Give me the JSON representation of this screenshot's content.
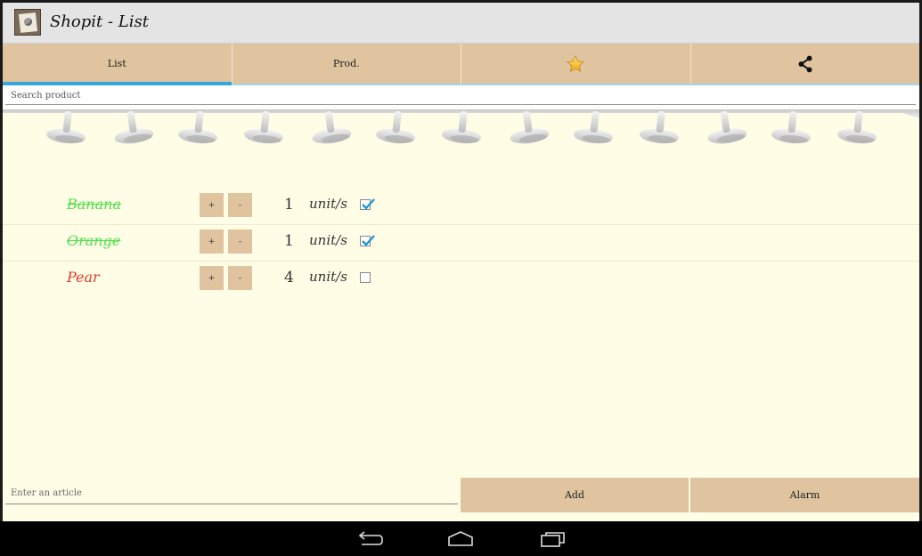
{
  "app": {
    "title": "Shopit - List"
  },
  "tabs": [
    {
      "label": "List",
      "active": true
    },
    {
      "label": "Prod.",
      "active": false
    },
    {
      "icon": "star-icon",
      "active": false
    },
    {
      "icon": "share-icon",
      "active": false
    }
  ],
  "search": {
    "placeholder": "Search product"
  },
  "list": {
    "items": [
      {
        "name": "Banana",
        "plus_label": "+",
        "minus_label": "-",
        "quantity": "1",
        "unit": "unit/s",
        "checked": true
      },
      {
        "name": "Orange",
        "plus_label": "+",
        "minus_label": "-",
        "quantity": "1",
        "unit": "unit/s",
        "checked": true
      },
      {
        "name": "Pear",
        "plus_label": "+",
        "minus_label": "-",
        "quantity": "4",
        "unit": "unit/s",
        "checked": false
      }
    ]
  },
  "bottom": {
    "article_placeholder": "Enter an article",
    "add_label": "Add",
    "alarm_label": "Alarm"
  },
  "navbar": {
    "buttons": [
      "back-icon",
      "home-icon",
      "recent-apps-icon"
    ]
  },
  "colors": {
    "accent": "#35a7df",
    "tab_bg": "#dfc49f",
    "paper": "#fffde6",
    "done_text": "#4de04a",
    "todo_text": "#e43a2a"
  }
}
